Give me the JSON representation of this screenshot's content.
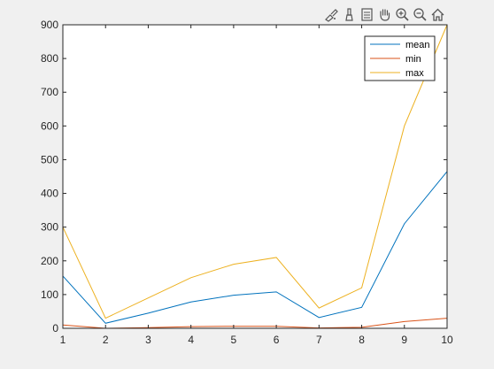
{
  "toolbar": {
    "buttons": [
      {
        "name": "brush-data-icon"
      },
      {
        "name": "data-tips-icon"
      },
      {
        "name": "legend-toggle-icon"
      },
      {
        "name": "pan-hand-icon"
      },
      {
        "name": "zoom-in-icon"
      },
      {
        "name": "zoom-out-icon"
      },
      {
        "name": "home-restore-view-icon"
      }
    ]
  },
  "chart_data": {
    "type": "line",
    "x": [
      1,
      2,
      3,
      4,
      5,
      6,
      7,
      8,
      9,
      10
    ],
    "series": [
      {
        "name": "mean",
        "color": "#0072BD",
        "values": [
          155,
          15,
          45,
          78,
          98,
          108,
          32,
          62,
          310,
          465
        ]
      },
      {
        "name": "min",
        "color": "#D95319",
        "values": [
          10,
          0,
          2,
          5,
          6,
          6,
          1,
          3,
          20,
          30
        ]
      },
      {
        "name": "max",
        "color": "#EDB120",
        "values": [
          300,
          30,
          90,
          150,
          190,
          210,
          60,
          120,
          600,
          900
        ]
      }
    ],
    "xlim": [
      1,
      10
    ],
    "ylim": [
      0,
      900
    ],
    "xticks": [
      "1",
      "2",
      "3",
      "4",
      "5",
      "6",
      "7",
      "8",
      "9",
      "10"
    ],
    "yticks": [
      "0",
      "100",
      "200",
      "300",
      "400",
      "500",
      "600",
      "700",
      "800",
      "900"
    ],
    "title": "",
    "xlabel": "",
    "ylabel": "",
    "legend_location": "top-right",
    "grid": false
  }
}
